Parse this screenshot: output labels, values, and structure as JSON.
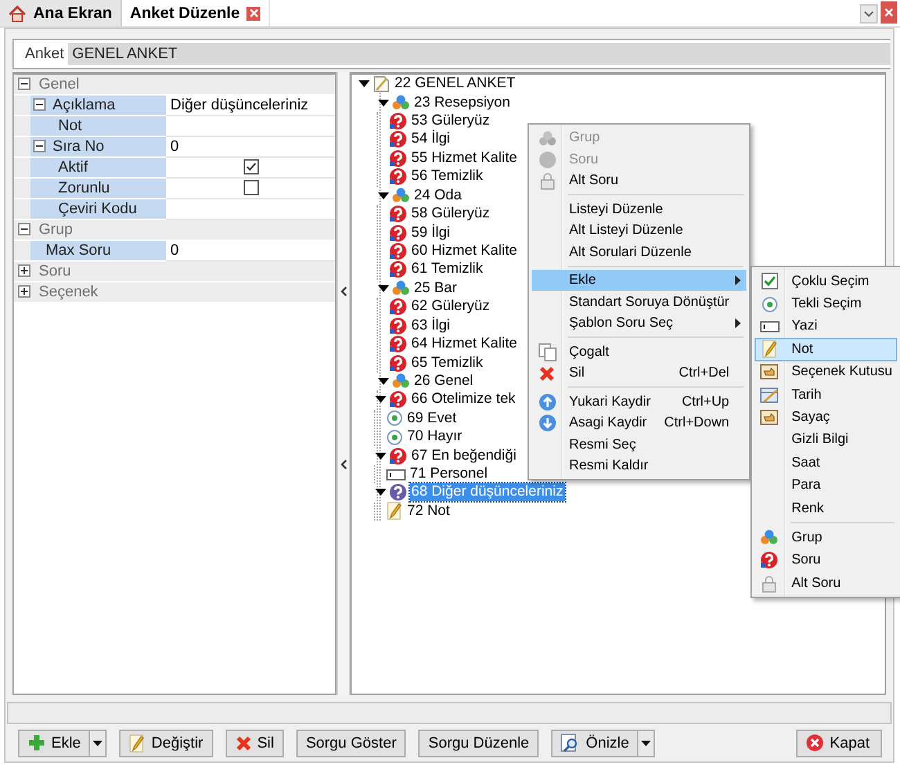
{
  "tabs": [
    {
      "label": "Ana Ekran",
      "kind": "home",
      "selected": false,
      "closable": false
    },
    {
      "label": "Anket Düzenle",
      "kind": "plain",
      "selected": true,
      "closable": true
    }
  ],
  "anket": {
    "label": "Anket",
    "value": "GENEL ANKET"
  },
  "properties": [
    {
      "name": "Genel",
      "expanded": true,
      "rows": [
        {
          "label": "Açıklama",
          "kind": "text",
          "value": "Diğer düşünceleriniz",
          "expanded": true,
          "children": [
            {
              "label": "Not",
              "kind": "text"
            }
          ]
        },
        {
          "label": "Sıra No",
          "kind": "text",
          "value": "0",
          "expanded": true,
          "children": [
            {
              "label": "Aktif",
              "kind": "check",
              "checked": true
            },
            {
              "label": "Zorunlu",
              "kind": "check",
              "checked": false
            },
            {
              "label": "Çeviri Kodu",
              "kind": "text"
            }
          ]
        }
      ]
    },
    {
      "name": "Grup",
      "expanded": true,
      "rows": [
        {
          "label": "Max Soru",
          "kind": "text",
          "value": "0"
        }
      ]
    },
    {
      "name": "Soru",
      "expanded": false
    },
    {
      "name": "Seçenek",
      "expanded": false
    }
  ],
  "tree": [
    {
      "kind": "survey",
      "label": "22 GENEL ANKET",
      "selected": false,
      "expanded": true,
      "children": [
        {
          "kind": "group",
          "label": "23 Resepsiyon",
          "selected": false,
          "expanded": true,
          "children": [
            {
              "kind": "question",
              "label": "53 Güleryüz",
              "selected": false
            },
            {
              "kind": "question",
              "label": "54 İlgi",
              "selected": false
            },
            {
              "kind": "question",
              "label": "55 Hizmet Kalite",
              "selected": false
            },
            {
              "kind": "question",
              "label": "56 Temizlik",
              "selected": false
            }
          ]
        },
        {
          "kind": "group",
          "label": "24 Oda",
          "selected": false,
          "expanded": true,
          "children": [
            {
              "kind": "question",
              "label": "58 Güleryüz",
              "selected": false
            },
            {
              "kind": "question",
              "label": "59 İlgi",
              "selected": false
            },
            {
              "kind": "question",
              "label": "60 Hizmet Kalite",
              "selected": false
            },
            {
              "kind": "question",
              "label": "61 Temizlik",
              "selected": false
            }
          ]
        },
        {
          "kind": "group",
          "label": "25 Bar",
          "selected": false,
          "expanded": true,
          "children": [
            {
              "kind": "question",
              "label": "62 Güleryüz",
              "selected": false
            },
            {
              "kind": "question",
              "label": "63 İlgi",
              "selected": false
            },
            {
              "kind": "question",
              "label": "64 Hizmet Kalite",
              "selected": false
            },
            {
              "kind": "question",
              "label": "65 Temizlik",
              "selected": false
            }
          ]
        },
        {
          "kind": "group",
          "label": "26 Genel",
          "selected": false,
          "expanded": true,
          "children": [
            {
              "kind": "question",
              "label": "66 Otelimize tek",
              "selected": false,
              "expanded": true,
              "children": [
                {
                  "kind": "option",
                  "label": "69 Evet",
                  "selected": false
                },
                {
                  "kind": "option",
                  "label": "70 Hayır",
                  "selected": false
                }
              ]
            },
            {
              "kind": "question",
              "label": "67 En beğendiği",
              "selected": false,
              "expanded": true,
              "children": [
                {
                  "kind": "text",
                  "label": "71 Personel",
                  "selected": false
                }
              ]
            },
            {
              "kind": "question",
              "label": "68 Diğer düşünceleriniz",
              "selected": true,
              "expanded": true,
              "children": [
                {
                  "kind": "note",
                  "label": "72 Not",
                  "selected": false
                }
              ]
            }
          ]
        }
      ]
    }
  ],
  "context_menu": {
    "items": [
      {
        "kind": "group",
        "label": "Grup",
        "disabled": true,
        "selected": false,
        "has_submenu": false
      },
      {
        "kind": "question",
        "label": "Soru",
        "disabled": true,
        "selected": false,
        "has_submenu": false
      },
      {
        "kind": "subquestion",
        "label": "Alt Soru",
        "disabled": false,
        "selected": false,
        "has_submenu": false
      },
      {
        "kind": "separator"
      },
      {
        "kind": "plain",
        "label": "Listeyi Düzenle",
        "disabled": false,
        "selected": false,
        "has_submenu": false
      },
      {
        "kind": "plain",
        "label": "Alt Listeyi Düzenle",
        "disabled": false,
        "selected": false,
        "has_submenu": false
      },
      {
        "kind": "plain",
        "label": "Alt Sorulari Düzenle",
        "disabled": false,
        "selected": false,
        "has_submenu": false
      },
      {
        "kind": "separator"
      },
      {
        "kind": "plain",
        "label": "Ekle",
        "disabled": false,
        "selected": true,
        "has_submenu": true
      },
      {
        "kind": "plain",
        "label": "Standart Soruya Dönüştür",
        "disabled": false,
        "selected": false,
        "has_submenu": false
      },
      {
        "kind": "plain",
        "label": "Şablon Soru Seç",
        "disabled": false,
        "selected": false,
        "has_submenu": true
      },
      {
        "kind": "separator"
      },
      {
        "kind": "copy",
        "label": "Çogalt",
        "disabled": false,
        "selected": false,
        "has_submenu": false
      },
      {
        "kind": "delete",
        "label": "Sil",
        "shortcut": "Ctrl+Del",
        "disabled": false,
        "selected": false,
        "has_submenu": false
      },
      {
        "kind": "separator"
      },
      {
        "kind": "up",
        "label": "Yukari Kaydir",
        "shortcut": "Ctrl+Up",
        "disabled": false,
        "selected": false,
        "has_submenu": false
      },
      {
        "kind": "down",
        "label": "Asagi Kaydir",
        "shortcut": "Ctrl+Down",
        "disabled": false,
        "selected": false,
        "has_submenu": false
      },
      {
        "kind": "plain",
        "label": "Resmi Seç",
        "disabled": false,
        "selected": false,
        "has_submenu": false
      },
      {
        "kind": "plain",
        "label": "Resmi Kaldır",
        "disabled": false,
        "selected": false,
        "has_submenu": false
      }
    ]
  },
  "submenu": {
    "items": [
      {
        "kind": "multi",
        "label": "Çoklu Seçim",
        "selected": false
      },
      {
        "kind": "single",
        "label": "Tekli Seçim",
        "selected": false
      },
      {
        "kind": "text",
        "label": "Yazi",
        "selected": false
      },
      {
        "kind": "note",
        "label": "Not",
        "selected": true
      },
      {
        "kind": "combo",
        "label": "Seçenek Kutusu",
        "selected": false
      },
      {
        "kind": "date",
        "label": "Tarih",
        "selected": false
      },
      {
        "kind": "combo",
        "label": "Sayaç",
        "selected": false
      },
      {
        "kind": "plain",
        "label": "Gizli Bilgi",
        "selected": false
      },
      {
        "kind": "plain",
        "label": "Saat",
        "selected": false
      },
      {
        "kind": "plain",
        "label": "Para",
        "selected": false
      },
      {
        "kind": "plain",
        "label": "Renk",
        "selected": false
      },
      {
        "kind": "separator"
      },
      {
        "kind": "group",
        "label": "Grup",
        "selected": false
      },
      {
        "kind": "question",
        "label": "Soru",
        "selected": false
      },
      {
        "kind": "subquestion",
        "label": "Alt Soru",
        "selected": false
      }
    ]
  },
  "toolbar": {
    "buttons": [
      {
        "kind": "add",
        "label": "Ekle",
        "dropdown": true
      },
      {
        "kind": "edit",
        "label": "Değiştir",
        "dropdown": false
      },
      {
        "kind": "delete",
        "label": "Sil",
        "dropdown": false
      },
      {
        "kind": "plain",
        "label": "Sorgu Göster",
        "dropdown": false
      },
      {
        "kind": "plain",
        "label": "Sorgu Düzenle",
        "dropdown": false
      },
      {
        "kind": "preview",
        "label": "Önizle",
        "dropdown": true
      }
    ],
    "close_button": {
      "label": "Kapat"
    }
  }
}
